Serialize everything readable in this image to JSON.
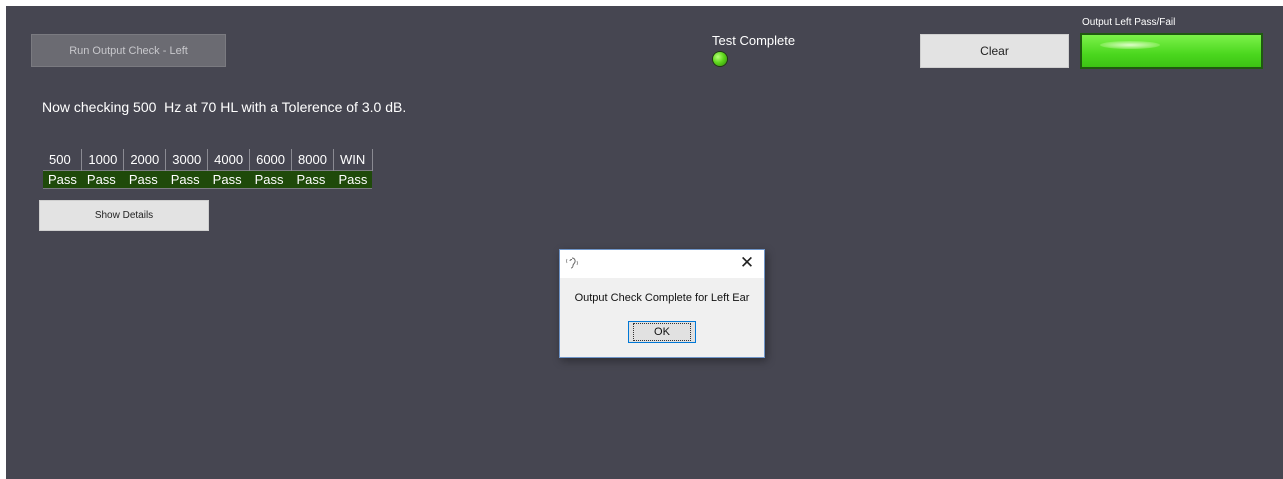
{
  "toolbar": {
    "run_label": "Run Output Check - Left",
    "clear_label": "Clear"
  },
  "status": {
    "label": "Test Complete",
    "led_color": "#5fd81c"
  },
  "pass_fail": {
    "label": "Output Left Pass/Fail",
    "state_color": "#4bd71e"
  },
  "main": {
    "message": "Now checking 500  Hz at 70 HL with a Tolerence of 3.0 dB.",
    "show_details_label": "Show Details"
  },
  "results": {
    "headers": [
      "500",
      "1000",
      "2000",
      "3000",
      "4000",
      "6000",
      "8000",
      "WIN"
    ],
    "values": [
      "Pass",
      "Pass",
      "Pass",
      "Pass",
      "Pass",
      "Pass",
      "Pass",
      "Pass"
    ],
    "pass_color": "#1f4a0a"
  },
  "dialog": {
    "icon": "hearing-aid-icon",
    "close_glyph": "✕",
    "message": "Output Check Complete for Left Ear",
    "ok_label": "OK"
  }
}
